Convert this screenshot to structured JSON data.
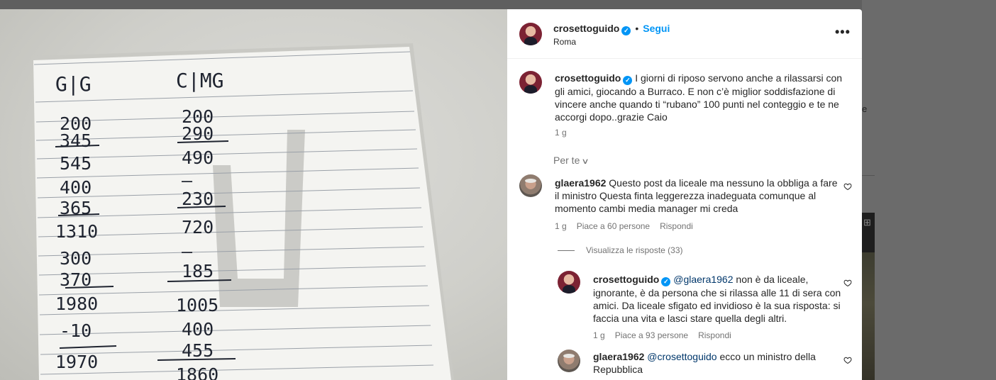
{
  "background_fragment": {
    "text": "e"
  },
  "photo": {
    "alt": "Burraco score sheet",
    "columns": [
      {
        "header": "G|G",
        "scores": [
          "200",
          "345",
          "545",
          "400",
          "365",
          "1310",
          "300",
          "370",
          "1980",
          "-10",
          "1970"
        ]
      },
      {
        "header": "C|MG",
        "scores": [
          "200",
          "290",
          "490",
          "—",
          "230",
          "720",
          "—",
          "185",
          "1005",
          "400",
          "455",
          "1860"
        ]
      }
    ]
  },
  "post": {
    "author": "crosettoguido",
    "verified": true,
    "follow_label": "Segui",
    "location": "Roma",
    "more_label": "•••",
    "caption": "I giorni di riposo servono anche a rilassarsi con gli amici, giocando a Burraco. E non c’è miglior soddisfazione di vincere anche quando ti “rubano” 100 punti nel conteggio e te ne accorgi dopo..grazie Caio",
    "caption_time": "1 g",
    "for_you_label": "Per te"
  },
  "comments": [
    {
      "author": "glaera1962",
      "text": "Questo post da liceale ma nessuno la obbliga a fare il ministro Questa finta leggerezza inadeguata comunque al momento cambi media manager mi creda",
      "time": "1 g",
      "likes": "Piace a 60 persone",
      "reply_label": "Rispondi",
      "view_replies_label": "Visualizza le risposte (33)",
      "replies": [
        {
          "author": "crosettoguido",
          "verified": true,
          "mention": "@glaera1962",
          "text": "non è da liceale, ignorante, è da persona che si rilassa alle 11 di sera con amici. Da liceale sfigato ed invidioso è la sua risposta: si faccia una vita e lasci stare quella degli altri.",
          "time": "1 g",
          "likes": "Piace a 93 persone",
          "reply_label": "Rispondi"
        },
        {
          "author": "glaera1962",
          "mention": "@crosettoguido",
          "text": "ecco un ministro della Repubblica"
        }
      ]
    }
  ],
  "colors": {
    "accent": "#0095f6",
    "verified": "#0095f6",
    "mention": "#00376b",
    "muted": "#737373"
  },
  "icons": [
    "verified-badge-icon",
    "more-options-icon",
    "chevron-down-icon",
    "heart-icon"
  ]
}
